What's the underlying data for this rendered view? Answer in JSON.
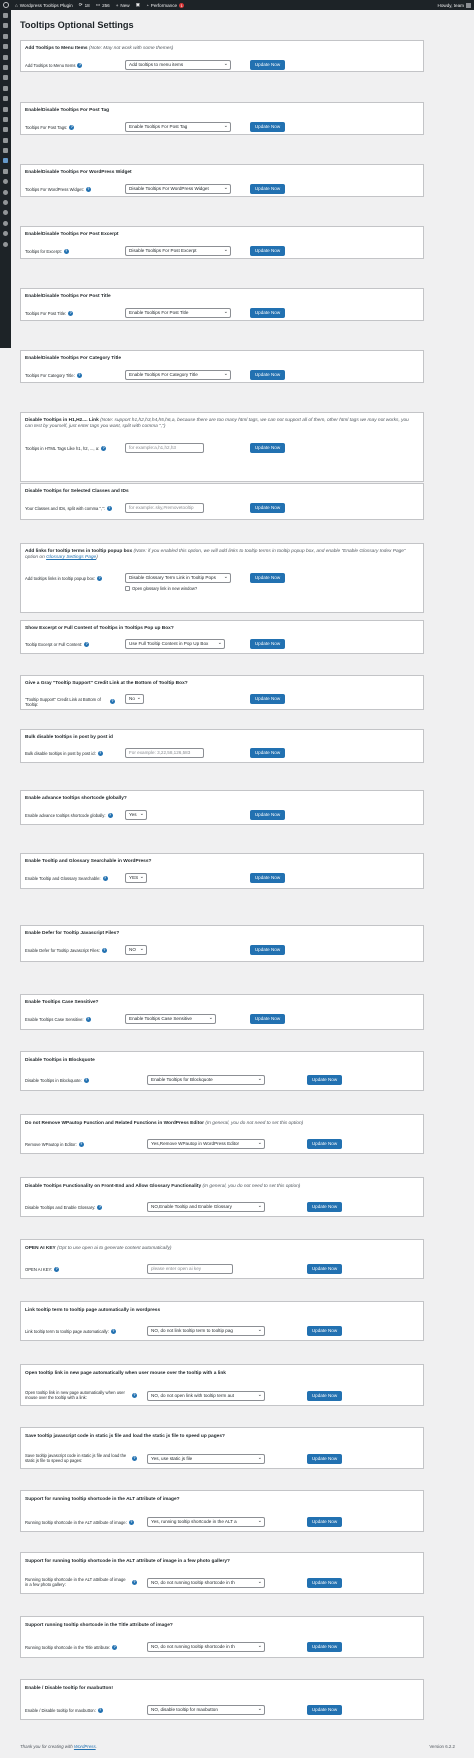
{
  "adminbar": {
    "site_name": "Wordpress Tooltips Plugin",
    "updates_count": "18",
    "comments_count": "256",
    "new_label": "New",
    "performance_label": "Performance",
    "performance_badge": "1",
    "howdy": "Howdy, team"
  },
  "page": {
    "title": "Tooltips Optional Settings"
  },
  "sections": [
    {
      "title": "Add Tooltips to Menu Items",
      "note": " (Note: May not work with some themes)",
      "label": "Add Tooltips to Menu Items",
      "control": "select",
      "value": "Add tooltips to menu items",
      "button": "Update Now"
    },
    {
      "title": "Enable/Disable Tooltips For Post Tag",
      "note": "",
      "label": "Tooltips For Post Tags:",
      "control": "select",
      "value": "Enable Tooltips For Post Tag",
      "button": "Update Now"
    },
    {
      "title": "Enable/Disable Tooltips For WordPress Widget",
      "note": "",
      "label": "Tooltips For WordPress Widget:",
      "control": "select",
      "value": "Disable Tooltips For WordPress Widget",
      "button": "Update Now"
    },
    {
      "title": "Enable/Disable Tooltips For Post Excerpt",
      "note": "",
      "label": "Tooltips for Excerpt:",
      "control": "select",
      "value": "Disable Tooltips For Post Excerpt",
      "button": "Update Now"
    },
    {
      "title": "Enable/Disable Tooltips For Post Title",
      "note": "",
      "label": "Tooltips For Post Title:",
      "control": "select",
      "value": "Enable Tooltips For Post Title",
      "button": "Update Now"
    },
    {
      "title": "Enable/Disable Tooltips For Category Title",
      "note": "",
      "label": "Tooltips For Category Title:",
      "control": "select",
      "value": "Enable Tooltips For Category Title",
      "button": "Update Now"
    },
    {
      "title": "Disable Tooltips in H1,H2.... Link",
      "note": " (Note: support h1,h2,h3,h4,h5,h6,a, because there are too many html tags, we can not support all of them, other html tags we may not works, you can test by yourself, just enter tags you want, split with comma \",\")",
      "label": "Tooltips in HTML Tags Like h1, h2, ..., a:",
      "control": "input",
      "placeholder": "for example:a,h1,h2,h3",
      "button": "Update Now"
    },
    {
      "title": "Disable Tooltips for Selected Classes and IDs",
      "note": "",
      "label": "Your Classes and IDs, split with comma \",\":",
      "control": "input",
      "placeholder": "for example:.sky,#removetooltip",
      "button": "Update Now"
    },
    {
      "title": "Add links for tooltip terms in tooltip popup box",
      "note": " (Note: if you enabled this option, we will add links to tooltip terms in tooltip popup box, and enable \"Enable Glossary Index Page\" option on ",
      "note_link": "Glossary Settings Page",
      "note_end": ")",
      "label": "Add tooltips links in tooltip popup box:",
      "control": "select",
      "value": "Disable Glossary Term Link in Tooltip Pops",
      "checkbox_label": "Open glossary link in new window?",
      "button": "Update Now"
    },
    {
      "title": "Show Excerpt or Full Content of Tooltips in Tooltips Pop up Box?",
      "note": "",
      "label": "Tooltip Excerpt or Full Content:",
      "control": "select",
      "value": "Use Full Tooltip Content in Pop Up Box",
      "button": "Update Now"
    },
    {
      "title": "Give a Gray \"Tooltip Support\" Credit Link at the Bottom of Tooltip Box?",
      "note": "",
      "label": "\"Tooltip Support\" Credit Link at Bottom of Tooltip:",
      "control": "select",
      "value": "No",
      "button": "Update Now"
    },
    {
      "title": "Bulk disable tooltips in post by post id",
      "note": "",
      "label": "Bulk disable tooltips in post by post id:",
      "control": "input",
      "placeholder": "For example: 3,22,58,126,583",
      "button": "Update Now"
    },
    {
      "title": "Enable advance tooltips shortcode globally?",
      "note": "",
      "label": "Enable advance tooltips shortcode globally:",
      "control": "select",
      "value": "Yes",
      "button": "Update Now"
    },
    {
      "title": "Enable Tooltip and Glossary Searchable in WordPress?",
      "note": "",
      "label": "Enable Tooltip and Glossary Searchable:",
      "control": "select",
      "value": "YES",
      "button": "Update Now"
    },
    {
      "title": "Enable Defer for Tooltip Javascript Files?",
      "note": "",
      "label": "Enable Defer for Tooltip Javascript Files:",
      "control": "select",
      "value": "NO",
      "button": "Update Now"
    },
    {
      "title": "Enable Tooltips Case Sensitive?",
      "note": "",
      "label": "Enable Tooltips Case Sensitive:",
      "control": "select",
      "value": "Enable Tooltips Case Sensitive",
      "button": "Update Now"
    },
    {
      "title": "Disable Tooltips in Blockquote",
      "note": "",
      "label": "Disable Tooltips in Blockquote:",
      "control": "select",
      "value": "Enable Tooltips for Blockquote",
      "button": "Update Now"
    },
    {
      "title": "Do not Remove WPautop Function and Related Functions in WordPress Editor",
      "note": " (In general, you do not need to set this option)",
      "label": "Remove WPautop in Editor:",
      "control": "select",
      "value": "Yes,Remove WPautop in WordPress Editor",
      "button": "Update Now"
    },
    {
      "title": "Disable Tooltips Functionality on Front-End and Allow Glossary Functionality",
      "note": " (In general, you do not need to set this option)",
      "label": "Disable Tooltips and Enable Glossary:",
      "control": "select",
      "value": "NO,Enable Tooltip and Enable Glossary",
      "button": "Update Now"
    },
    {
      "title": "OPEN AI KEY",
      "note": " (Opt to use open ai to generate content automatically)",
      "label": "OPEN AI KEY:",
      "control": "input",
      "placeholder": "please enter open ai key",
      "button": "Update Now"
    },
    {
      "title": "Link tooltip term to tooltip page automatically in wordpress",
      "note": "",
      "label": "Link tooltip term to tooltip page automatically:",
      "control": "select",
      "value": "NO, do not link tooltip term to tooltip pag",
      "button": "Update Now"
    },
    {
      "title": "Open tooltip link in new page automatically when user mouse over the tooltip with a link",
      "note": "",
      "label": "Open tooltip link in new page automatically when user mouse over the tooltip with a link:",
      "control": "select",
      "value": "NO, do not open link with tooltip term aut",
      "button": "Update Now"
    },
    {
      "title": "Save tooltip javascript code in static js file and load the static js file to speed up pages?",
      "note": "",
      "label": "Save tooltip javascript code in static js file and load the static js file to speed up pages:",
      "control": "select",
      "value": "Yes, use static js file",
      "button": "Update Now"
    },
    {
      "title": "Support for running tooltip shortcode in the ALT attribute of image?",
      "note": "",
      "label": "Running tooltip shortcode in the ALT attribute of image:",
      "control": "select",
      "value": "Yes, running tooltip shortcode in the ALT a",
      "button": "Update Now"
    },
    {
      "title": "Support for running tooltip shortcode in the ALT attribute of image in a few photo gallery?",
      "note": "",
      "label": "Running tooltip shortcode in the ALT attribute of image in a few photo gallery:",
      "control": "select",
      "value": "NO, do not running tooltip shortcode in th",
      "button": "Update Now"
    },
    {
      "title": "Support running tooltip shortcode in the Title attribute of image?",
      "note": "",
      "label": "Running tooltip shortcode in the Title attribute:",
      "control": "select",
      "value": "NO, do not running tooltip shortcode in th",
      "button": "Update Now"
    },
    {
      "title": "Enable / Disable tooltip for maxbutton!",
      "note": "",
      "label": "Enable / Disable tooltip for maxbutton:",
      "control": "select",
      "value": "NO, disable tooltip for maxbutton",
      "button": "Update Now"
    }
  ],
  "footer": {
    "thanks_prefix": "Thank you for creating with ",
    "thanks_link": "WordPress",
    "thanks_suffix": ".",
    "version": "Version 6.2.2"
  }
}
